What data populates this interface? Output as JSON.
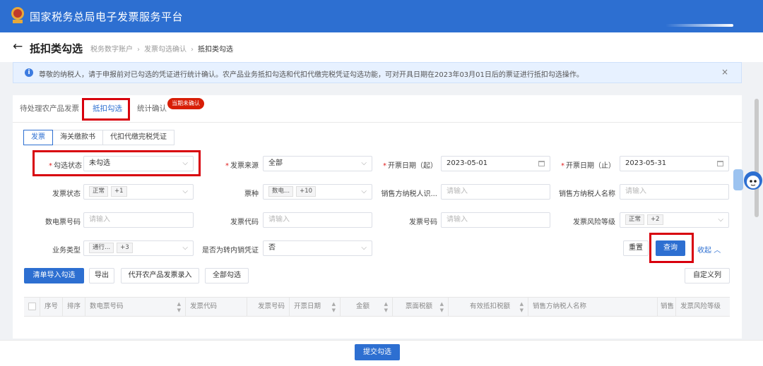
{
  "app": {
    "title": "国家税务总局电子发票服务平台"
  },
  "page": {
    "title": "抵扣类勾选",
    "breadcrumb": [
      "税务数字账户",
      "发票勾选确认",
      "抵扣类勾选"
    ]
  },
  "notice": {
    "text": "尊敬的纳税人，请于申报前对已勾选的凭证进行统计确认。农产品业务抵扣勾选和代扣代缴完税凭证勾选功能，可对开具日期在2023年03月01日后的票证进行抵扣勾选操作。",
    "close": "×"
  },
  "tabs": [
    {
      "label": "待处理农产品发票"
    },
    {
      "label": "抵扣勾选"
    },
    {
      "label": "统计确认"
    }
  ],
  "badge": "当期未确认",
  "subtabs": [
    "发票",
    "海关缴款书",
    "代扣代缴完税凭证"
  ],
  "filters": {
    "select_status": {
      "label": "勾选状态",
      "value": "未勾选"
    },
    "invoice_source": {
      "label": "发票来源",
      "value": "全部"
    },
    "issue_date_start": {
      "label": "开票日期（起）",
      "value": "2023-05-01"
    },
    "issue_date_end": {
      "label": "开票日期（止）",
      "value": "2023-05-31"
    },
    "invoice_status": {
      "label": "发票状态",
      "tag": "正常",
      "more": "+1"
    },
    "ticket_type": {
      "label": "票种",
      "tag": "数电...",
      "more": "+10"
    },
    "seller_tax_id": {
      "label": "销售方纳税人识...",
      "placeholder": "请输入"
    },
    "seller_name": {
      "label": "销售方纳税人名称",
      "placeholder": "请输入"
    },
    "e_invoice_no": {
      "label": "数电票号码",
      "placeholder": "请输入"
    },
    "invoice_code": {
      "label": "发票代码",
      "placeholder": "请输入"
    },
    "invoice_no": {
      "label": "发票号码",
      "placeholder": "请输入"
    },
    "risk_level": {
      "label": "发票风险等级",
      "tag": "正常",
      "more": "+2"
    },
    "business_type": {
      "label": "业务类型",
      "tag": "通行...",
      "more": "+3"
    },
    "is_transfer": {
      "label": "是否为转内销凭证",
      "value": "否"
    }
  },
  "actions": {
    "reset": "重置",
    "query": "查询",
    "collapse": "收起"
  },
  "toolbar": {
    "import": "清单导入勾选",
    "export": "导出",
    "agri_entry": "代开农产品发票录入",
    "select_all": "全部勾选",
    "custom_columns": "自定义列"
  },
  "table": {
    "columns": [
      "序号",
      "排序",
      "数电票号码",
      "发票代码",
      "发票号码",
      "开票日期",
      "金额",
      "票面税额",
      "有效抵扣税额",
      "销售方纳税人名称",
      "销售",
      "发票风险等级"
    ]
  },
  "footer": {
    "submit": "提交勾选"
  },
  "assistant": {
    "label": "征纳互动"
  },
  "colors": {
    "primary": "#2d6fd1",
    "highlight": "#d8000c",
    "badge": "#d81e06"
  }
}
